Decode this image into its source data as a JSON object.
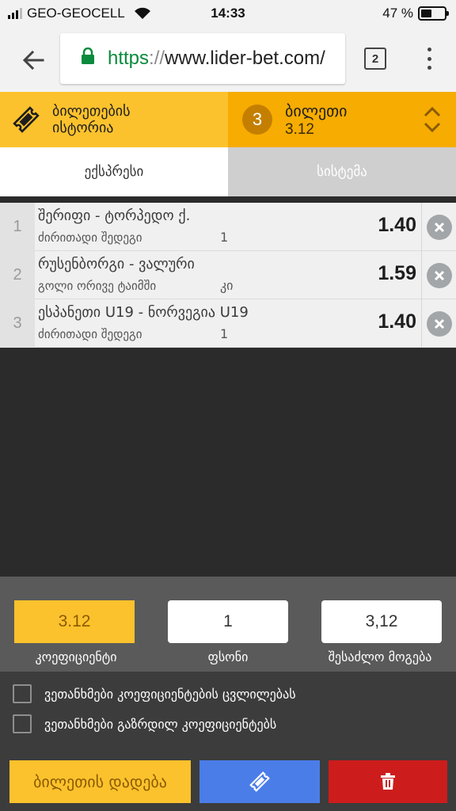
{
  "status_bar": {
    "carrier": "GEO-GEOCELL",
    "time": "14:33",
    "battery_percent": "47 %",
    "battery_level": 0.47,
    "signal_bars": 3
  },
  "browser": {
    "url_scheme": "https",
    "url_sep": "://",
    "url_host": "www.lider-bet.com/",
    "tab_count": "2"
  },
  "header": {
    "history_label": "ბილეთების ისტორია",
    "ticket_count": "3",
    "ticket_label": "ბილეთი",
    "ticket_odds": "3.12"
  },
  "bet_tabs": [
    {
      "label": "ექსპრესი",
      "active": true
    },
    {
      "label": "სისტემა",
      "active": false
    }
  ],
  "bets": [
    {
      "num": "1",
      "event": "შერიფი - ტორპედო ქ.",
      "market": "ძირითადი შედეგი",
      "pick": "1",
      "odd": "1.40"
    },
    {
      "num": "2",
      "event": "რუსენბორგი - ვალური",
      "market": "გოლი ორივე ტაიმში",
      "pick": "კი",
      "odd": "1.59"
    },
    {
      "num": "3",
      "event": "ესპანეთი U19 - ნორვეგია U19",
      "market": "ძირითადი შედეგი",
      "pick": "1",
      "odd": "1.40"
    }
  ],
  "summary": {
    "coef_value": "3.12",
    "coef_label": "კოეფიციენტი",
    "stake_value": "1",
    "stake_label": "ფსონი",
    "win_value": "3,12",
    "win_label": "შესაძლო მოგება"
  },
  "options": [
    {
      "label": "ვეთანხმები კოეფიციენტების ცვლილებას",
      "checked": false
    },
    {
      "label": "ვეთანხმები გაზრდილ კოეფიციენტებს",
      "checked": false
    }
  ],
  "actions": {
    "place_label": "ბილეთის დადება"
  },
  "colors": {
    "accent_yellow": "#fcc22d",
    "ticket_orange": "#f6ac00",
    "save_blue": "#4a7de8",
    "delete_red": "#cd1c1c"
  }
}
